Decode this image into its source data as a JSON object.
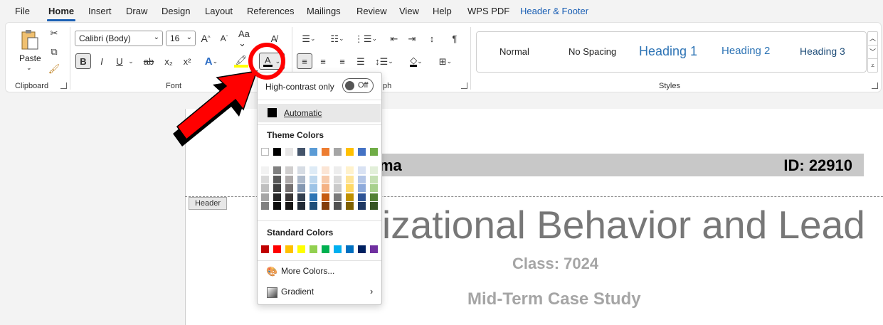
{
  "menu": {
    "items": [
      "File",
      "Home",
      "Insert",
      "Draw",
      "Design",
      "Layout",
      "References",
      "Mailings",
      "Review",
      "View",
      "Help",
      "WPS PDF",
      "Header & Footer"
    ],
    "active": "Home"
  },
  "ribbon": {
    "clipboard": {
      "paste_label": "Paste",
      "group_label": "Clipboard"
    },
    "font": {
      "name": "Calibri (Body)",
      "size": "16",
      "group_label": "Font",
      "bold": "B",
      "italic": "I",
      "underline": "U",
      "strike": "ab",
      "subscript": "x₂",
      "superscript": "x²",
      "font_color_letter": "A",
      "grow": "A^",
      "shrink": "Aˇ",
      "case": "Aa"
    },
    "paragraph": {
      "group_label_visible": "ph"
    },
    "styles": {
      "group_label": "Styles",
      "items": [
        "Normal",
        "No Spacing",
        "Heading 1",
        "Heading 2",
        "Heading 3"
      ]
    }
  },
  "popup": {
    "high_contrast_label": "High-contrast only",
    "toggle_value": "Off",
    "automatic_label": "Automatic",
    "theme_title": "Theme Colors",
    "standard_title": "Standard Colors",
    "more_colors": "More Colors...",
    "gradient": "Gradient",
    "theme_colors": [
      "#FFFFFF",
      "#000000",
      "#E7E6E6",
      "#44546A",
      "#5B9BD5",
      "#ED7D31",
      "#A5A5A5",
      "#FFC000",
      "#4472C4",
      "#70AD47"
    ],
    "theme_shades": [
      [
        "#F2F2F2",
        "#D9D9D9",
        "#BFBFBF",
        "#A6A6A6",
        "#808080"
      ],
      [
        "#808080",
        "#595959",
        "#404040",
        "#262626",
        "#0D0D0D"
      ],
      [
        "#D0CECE",
        "#AEAAAA",
        "#757171",
        "#3B3838",
        "#171616"
      ],
      [
        "#D6DCE4",
        "#ADB9CA",
        "#8497B0",
        "#333F4F",
        "#222A35"
      ],
      [
        "#DEEBF6",
        "#BDD7EE",
        "#9DC3E6",
        "#2E75B5",
        "#1F4E79"
      ],
      [
        "#FBE5D5",
        "#F7CBAC",
        "#F4B183",
        "#C55A11",
        "#833C0B"
      ],
      [
        "#EDEDED",
        "#DBDBDB",
        "#C9C9C9",
        "#7B7B7B",
        "#525252"
      ],
      [
        "#FFF2CC",
        "#FFE599",
        "#FFD966",
        "#BF9000",
        "#7F6000"
      ],
      [
        "#D9E2F3",
        "#B4C6E7",
        "#8EAADB",
        "#2F5496",
        "#1F3864"
      ],
      [
        "#E2EFD9",
        "#C5E0B3",
        "#A8D08D",
        "#538135",
        "#375623"
      ]
    ],
    "standard_colors": [
      "#C00000",
      "#FF0000",
      "#FFC000",
      "#FFFF00",
      "#92D050",
      "#00B050",
      "#00B0F0",
      "#0070C0",
      "#002060",
      "#7030A0"
    ]
  },
  "document": {
    "banner_left": "ma",
    "banner_right": "ID: 22910",
    "header_tag": "Header",
    "title": "izational Behavior and Lead",
    "class_line": "Class: 7024",
    "subtitle": "Mid-Term Case Study"
  },
  "colors": {
    "accent": "#1a5fb4",
    "annotation_red": "#ff0000"
  }
}
